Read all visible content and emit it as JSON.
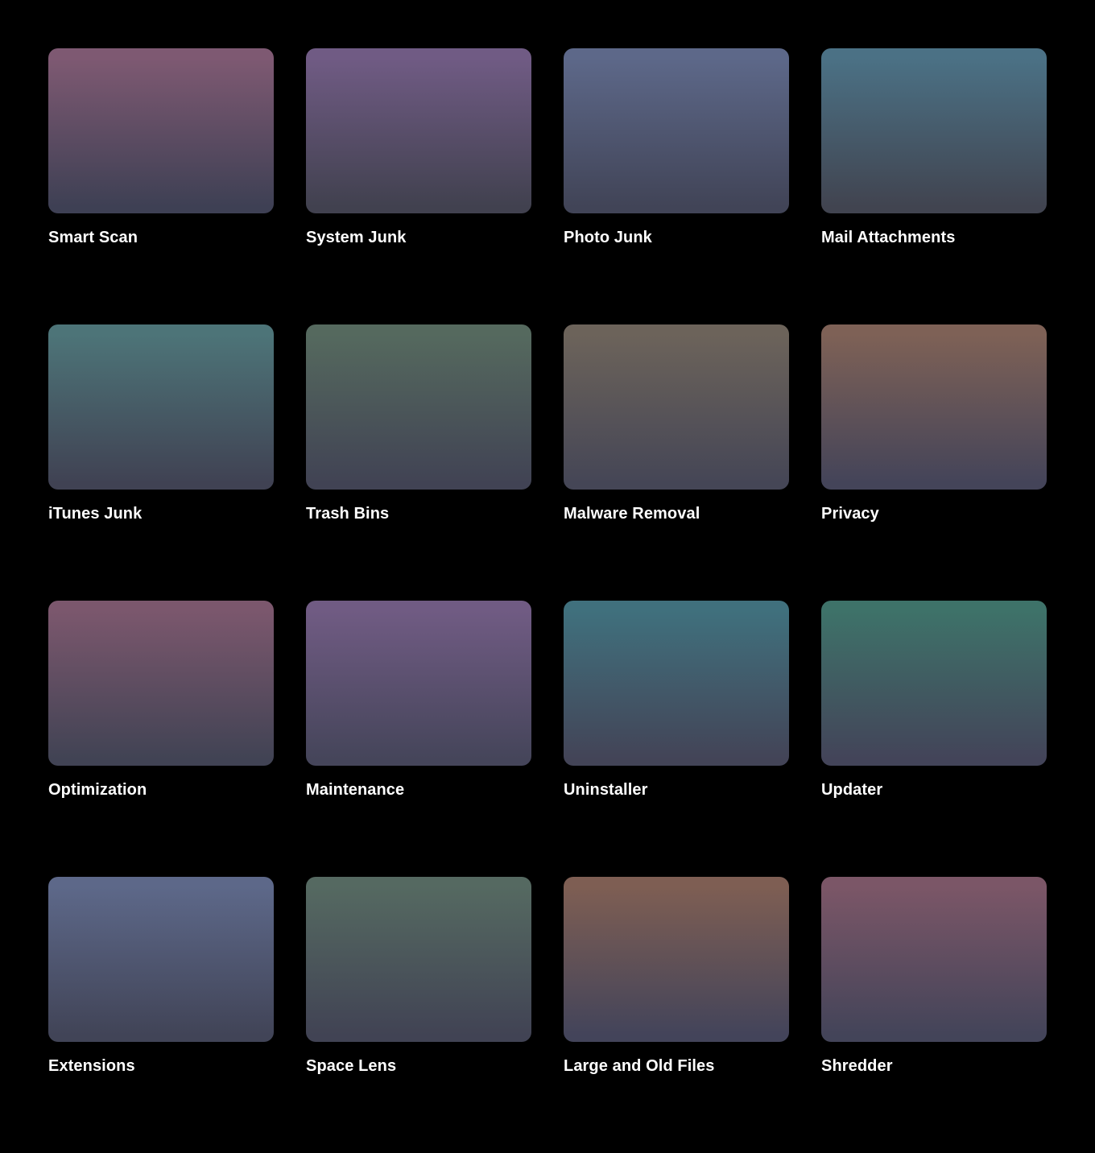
{
  "page": {
    "background_color": "#000000",
    "label_color": "#ffffff",
    "layout": "grid-4x4"
  },
  "tiles": [
    {
      "label": "Smart Scan",
      "icon": "smart-scan-thumbnail",
      "gradient_top": "#7e5972",
      "gradient_bottom": "#3e4054"
    },
    {
      "label": "System Junk",
      "icon": "system-junk-thumbnail",
      "gradient_top": "#705b84",
      "gradient_bottom": "#41414f"
    },
    {
      "label": "Photo Junk",
      "icon": "photo-junk-thumbnail",
      "gradient_top": "#5d6889",
      "gradient_bottom": "#414457"
    },
    {
      "label": "Mail Attachments",
      "icon": "mail-attachments-thumbnail",
      "gradient_top": "#4b7185",
      "gradient_bottom": "#414450"
    },
    {
      "label": "iTunes Junk",
      "icon": "itunes-junk-thumbnail",
      "gradient_top": "#4d7478",
      "gradient_bottom": "#404253"
    },
    {
      "label": "Trash Bins",
      "icon": "trash-bins-thumbnail",
      "gradient_top": "#55695e",
      "gradient_bottom": "#414354"
    },
    {
      "label": "Malware Removal",
      "icon": "malware-removal-thumbnail",
      "gradient_top": "#6c635a",
      "gradient_bottom": "#454656"
    },
    {
      "label": "Privacy",
      "icon": "privacy-thumbnail",
      "gradient_top": "#7e6156",
      "gradient_bottom": "#444459"
    },
    {
      "label": "Optimization",
      "icon": "optimization-thumbnail",
      "gradient_top": "#7b576d",
      "gradient_bottom": "#414354"
    },
    {
      "label": "Maintenance",
      "icon": "maintenance-thumbnail",
      "gradient_top": "#705b83",
      "gradient_bottom": "#45455a"
    },
    {
      "label": "Uninstaller",
      "icon": "uninstaller-thumbnail",
      "gradient_top": "#40707d",
      "gradient_bottom": "#434457"
    },
    {
      "label": "Updater",
      "icon": "updater-thumbnail",
      "gradient_top": "#3e7269",
      "gradient_bottom": "#434459"
    },
    {
      "label": "Extensions",
      "icon": "extensions-thumbnail",
      "gradient_top": "#5d6889",
      "gradient_bottom": "#414457"
    },
    {
      "label": "Space Lens",
      "icon": "space-lens-thumbnail",
      "gradient_top": "#556961",
      "gradient_bottom": "#414354"
    },
    {
      "label": "Large and Old Files",
      "icon": "large-and-old-files-thumbnail",
      "gradient_top": "#7e5e53",
      "gradient_bottom": "#43445a"
    },
    {
      "label": "Shredder",
      "icon": "shredder-thumbnail",
      "gradient_top": "#7b5667",
      "gradient_bottom": "#434459"
    }
  ]
}
